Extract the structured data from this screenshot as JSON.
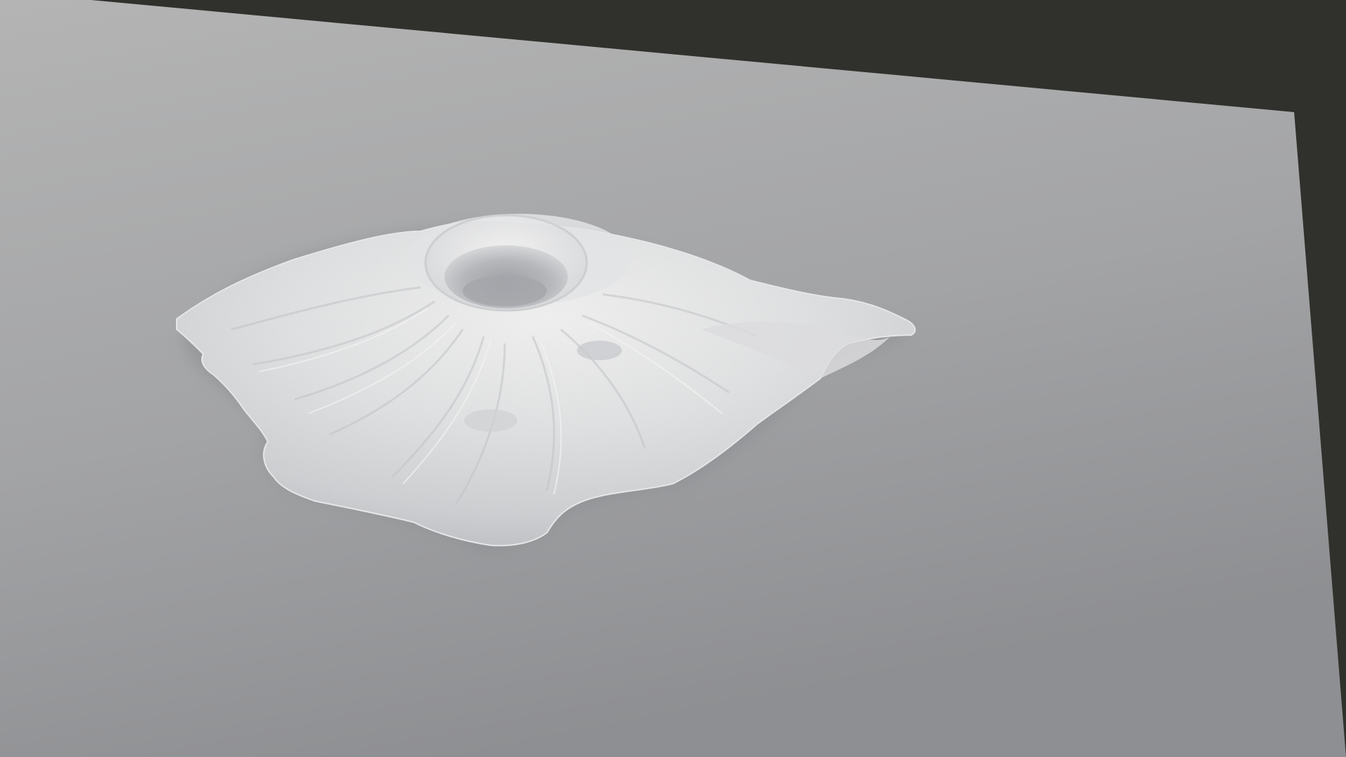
{
  "scene": {
    "subject": "volcano-terrain-model",
    "colors": {
      "background": "#30312c",
      "ground_plane_light": "#b3b3b3",
      "ground_plane_dark": "#929395",
      "terrain_highlight": "#f1f1f1",
      "terrain_midtone": "#d6d7d9",
      "terrain_shadow": "#a9aaae",
      "crater_shadow": "#9fa1a6"
    }
  }
}
